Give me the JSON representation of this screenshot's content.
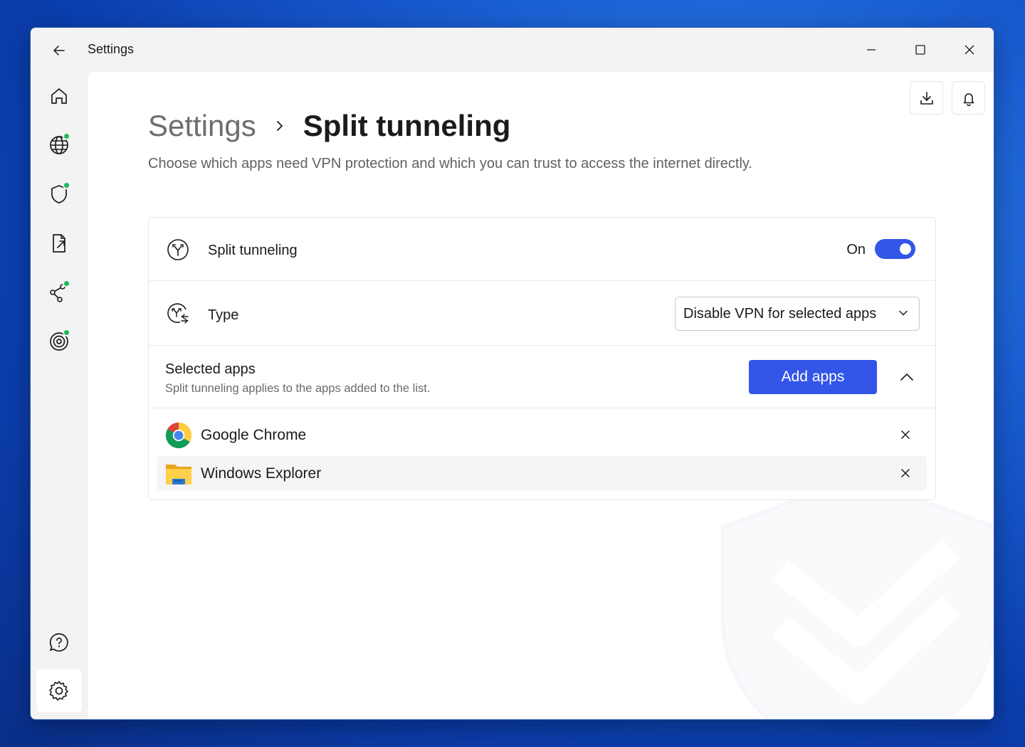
{
  "window": {
    "title": "Settings"
  },
  "breadcrumb": {
    "root": "Settings",
    "current": "Split tunneling"
  },
  "subtitle": "Choose which apps need VPN protection and which you can trust to access the internet directly.",
  "split_tunneling": {
    "label": "Split tunneling",
    "state_text": "On",
    "enabled": true
  },
  "type": {
    "label": "Type",
    "selected": "Disable VPN for selected apps"
  },
  "selected_apps": {
    "title": "Selected apps",
    "description": "Split tunneling applies to the apps added to the list.",
    "add_button": "Add apps",
    "apps": [
      {
        "name": "Google Chrome",
        "icon": "chrome-icon"
      },
      {
        "name": "Windows Explorer",
        "icon": "folder-icon"
      }
    ]
  },
  "colors": {
    "accent": "#3356e8",
    "status_dot": "#1fb85a"
  }
}
